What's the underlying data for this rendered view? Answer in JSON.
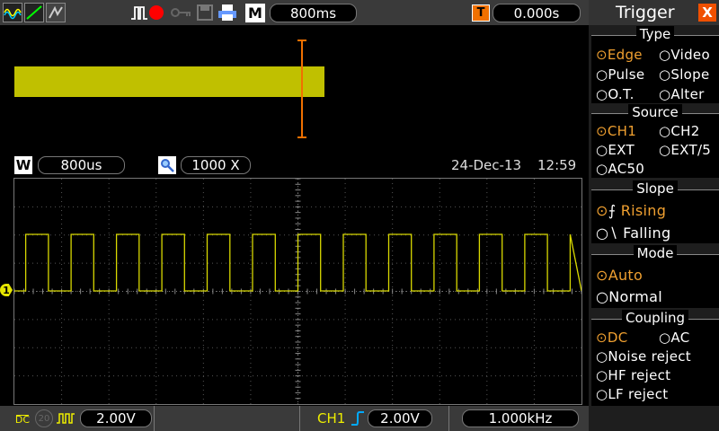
{
  "top": {
    "mode_letter": "M",
    "timebase": "800ms",
    "trig_letter": "T",
    "trigger_time": "0.000s"
  },
  "zoom": {
    "w_letter": "W",
    "window_timebase": "800us",
    "zoom_factor": "1000 X",
    "date": "24-Dec-13",
    "time": "12:59"
  },
  "channel": {
    "marker": "1"
  },
  "bottom": {
    "coupling": "DC",
    "bw_limit": "20",
    "ch_scale": "2.00V",
    "trig_source": "CH1",
    "trig_level": "2.00V",
    "frequency": "1.000kHz"
  },
  "menu": {
    "title": "Trigger",
    "close_label": "X",
    "groups": [
      {
        "title": "Type",
        "options": [
          "Edge",
          "Video",
          "Pulse",
          "Slope",
          "O.T.",
          "Alter"
        ],
        "selected": "Edge"
      },
      {
        "title": "Source",
        "options": [
          "CH1",
          "CH2",
          "EXT",
          "EXT/5",
          "AC50"
        ],
        "selected": "CH1"
      },
      {
        "title": "Slope",
        "options": [
          "Rising",
          "Falling"
        ],
        "selected": "Rising"
      },
      {
        "title": "Mode",
        "options": [
          "Auto",
          "Normal"
        ],
        "selected": "Auto"
      },
      {
        "title": "Coupling",
        "options": [
          "DC",
          "AC",
          "Noise reject",
          "HF reject",
          "LF reject"
        ],
        "selected": "DC"
      }
    ]
  },
  "colors": {
    "trace": "#d8d800",
    "accent": "#f07000",
    "selected": "#f0a030"
  },
  "waveform": {
    "periods_on_screen": 12.5,
    "duty_cycle": 0.5,
    "trigger_position_fraction": 0.5
  }
}
